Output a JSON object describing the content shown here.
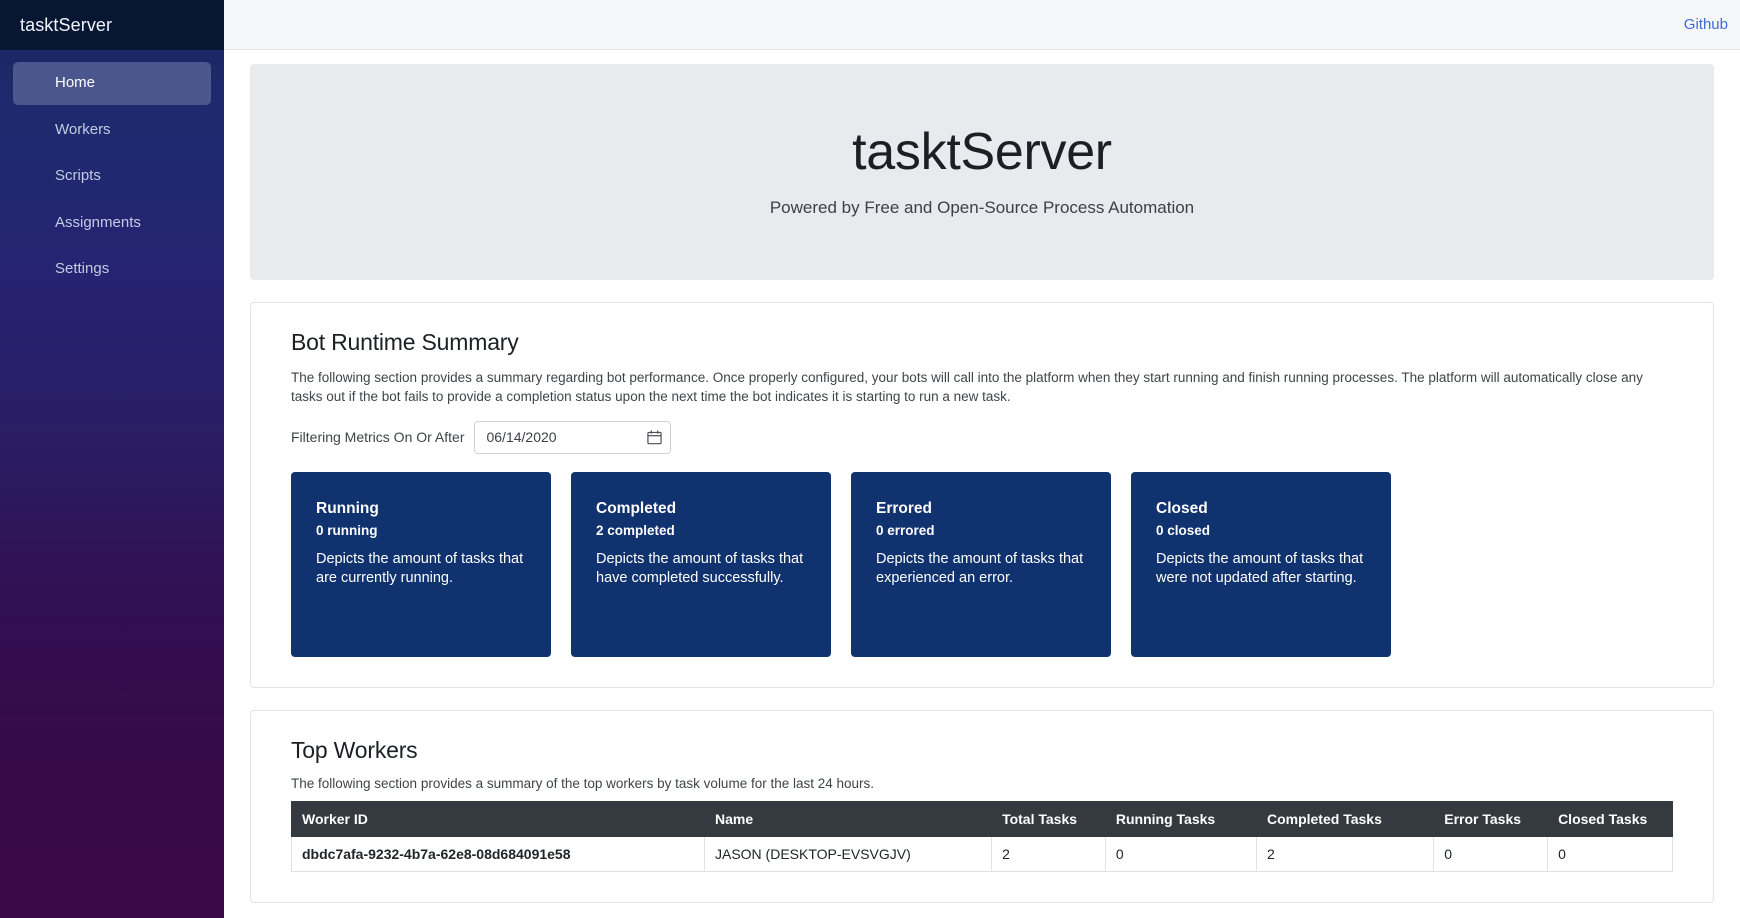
{
  "sidebar": {
    "brand": "tasktServer",
    "items": [
      {
        "label": "Home",
        "active": true
      },
      {
        "label": "Workers",
        "active": false
      },
      {
        "label": "Scripts",
        "active": false
      },
      {
        "label": "Assignments",
        "active": false
      },
      {
        "label": "Settings",
        "active": false
      }
    ]
  },
  "topbar": {
    "github_label": "Github"
  },
  "hero": {
    "title": "tasktServer",
    "subtitle": "Powered by Free and Open-Source Process Automation"
  },
  "runtime_summary": {
    "title": "Bot Runtime Summary",
    "description": "The following section provides a summary regarding bot performance. Once properly configured, your bots will call into the platform when they start running and finish running processes. The platform will automatically close any tasks out if the bot fails to provide a completion status upon the next time the bot indicates it is starting to run a new task.",
    "filter_label": "Filtering Metrics On Or After",
    "filter_date": "06/14/2020",
    "filter_placeholder": "mm/dd/yyyy",
    "calendar_icon": "calendar-icon",
    "card_color": "#10326f",
    "cards": [
      {
        "title": "Running",
        "count": "0 running",
        "description": "Depicts the amount of tasks that are currently running."
      },
      {
        "title": "Completed",
        "count": "2 completed",
        "description": "Depicts the amount of tasks that have completed successfully."
      },
      {
        "title": "Errored",
        "count": "0 errored",
        "description": "Depicts the amount of tasks that experienced an error."
      },
      {
        "title": "Closed",
        "count": "0 closed",
        "description": "Depicts the amount of tasks that were not updated after starting."
      }
    ]
  },
  "top_workers": {
    "title": "Top Workers",
    "description": "The following section provides a summary of the top workers by task volume for the last 24 hours.",
    "columns": [
      "Worker ID",
      "Name",
      "Total Tasks",
      "Running Tasks",
      "Completed Tasks",
      "Error Tasks",
      "Closed Tasks"
    ],
    "rows": [
      {
        "worker_id": "dbdc7afa-9232-4b7a-62e8-08d684091e58",
        "name": "JASON (DESKTOP-EVSVGJV)",
        "total_tasks": "2",
        "running_tasks": "0",
        "completed_tasks": "2",
        "error_tasks": "0",
        "closed_tasks": "0"
      }
    ]
  },
  "colors": {
    "accent_link": "#4169d8",
    "sidebar_top": "#16255e",
    "sidebar_bottom": "#3a0a46",
    "table_header": "#343a40",
    "hero_bg": "#e8eaed"
  }
}
